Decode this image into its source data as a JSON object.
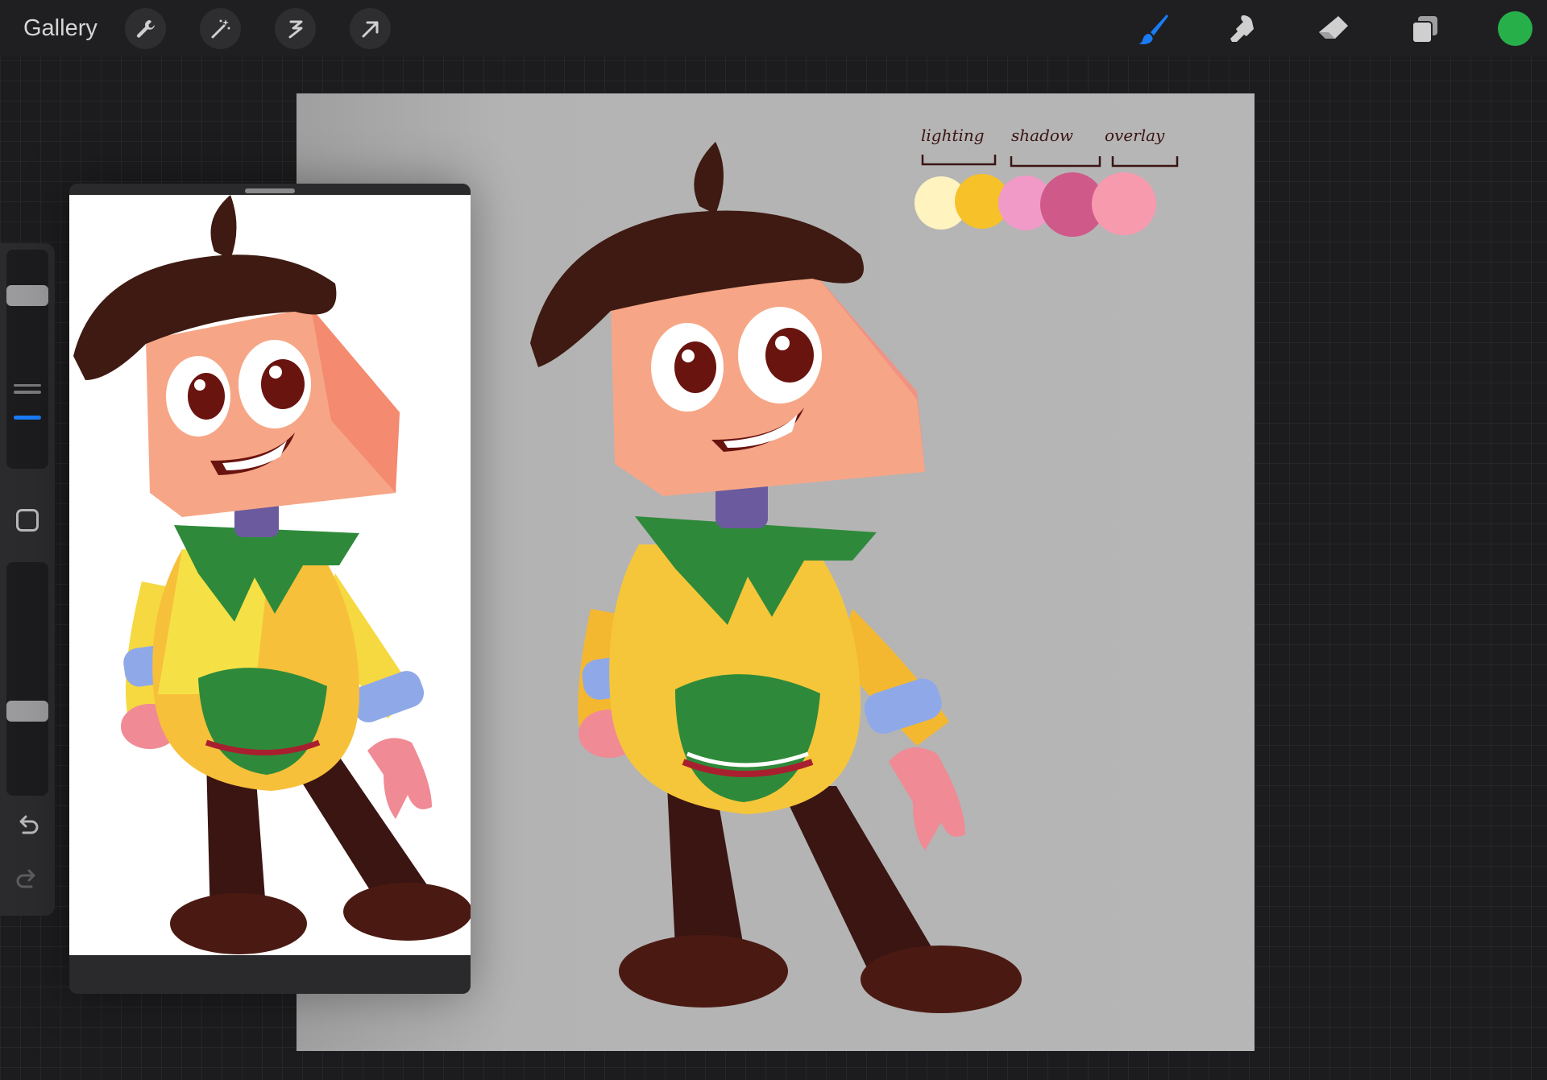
{
  "toolbar": {
    "gallery_label": "Gallery",
    "left_tools": [
      "wrench-icon",
      "magic-wand-icon",
      "selection-icon",
      "transform-arrow-icon"
    ],
    "right_tools": [
      "brush-icon",
      "smudge-icon",
      "eraser-icon",
      "layers-icon"
    ],
    "active_tool": "brush-icon",
    "accent_color": "#1a7cf5",
    "current_color": "#27b04a"
  },
  "sidebar": {
    "size_slider_level": 0.82,
    "opacity_slider_level": 0.35,
    "icons": [
      "modify-square-icon",
      "undo-icon",
      "redo-icon"
    ]
  },
  "canvas": {
    "background_color": "#b4b4b4",
    "palette": {
      "groups": [
        "lighting",
        "shadow",
        "overlay"
      ],
      "swatches": [
        "#fff3c0",
        "#f7c12a",
        "#f19ac8",
        "#cf5a8a",
        "#f89aae"
      ]
    }
  },
  "reference": {
    "title": ""
  }
}
